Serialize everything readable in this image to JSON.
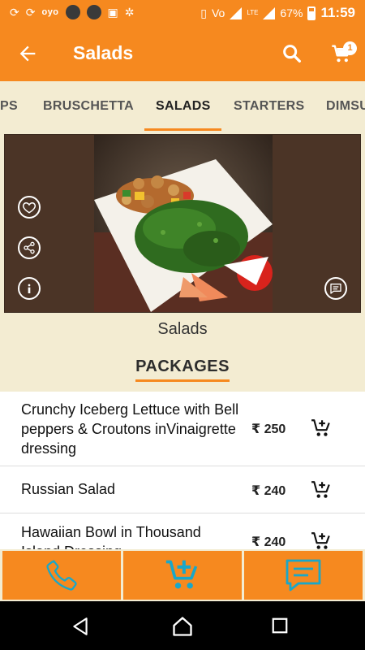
{
  "status_bar": {
    "carrier": "oyo",
    "battery": "67%",
    "time": "11:59",
    "network": "LTE"
  },
  "app_bar": {
    "title": "Salads",
    "cart_count": "1"
  },
  "tabs": [
    {
      "label": "PS"
    },
    {
      "label": "BRUSCHETTA"
    },
    {
      "label": "SALADS",
      "active": true
    },
    {
      "label": "STARTERS"
    },
    {
      "label": "DIMSU"
    }
  ],
  "hero": {
    "caption": "Salads"
  },
  "packages": {
    "title": "PACKAGES",
    "items": [
      {
        "name": "Crunchy Iceberg Lettuce with Bell peppers & Croutons inVinaigrette dressing",
        "price": "₹ 250"
      },
      {
        "name": "Russian Salad",
        "price": "₹ 240"
      },
      {
        "name": "Hawaiian Bowl in Thousand Island Dressing",
        "price": "₹ 240"
      }
    ]
  },
  "colors": {
    "accent": "#f6891f",
    "background": "#f3ecd2",
    "icon_teal": "#19a7c9"
  },
  "icons": {
    "back": "arrow-left",
    "search": "magnifier",
    "cart": "shopping-cart",
    "favorite": "heart-outline",
    "share": "share",
    "info": "info",
    "comment": "chat-bubble",
    "add_to_cart": "cart-plus",
    "call": "phone",
    "message": "message-square"
  }
}
